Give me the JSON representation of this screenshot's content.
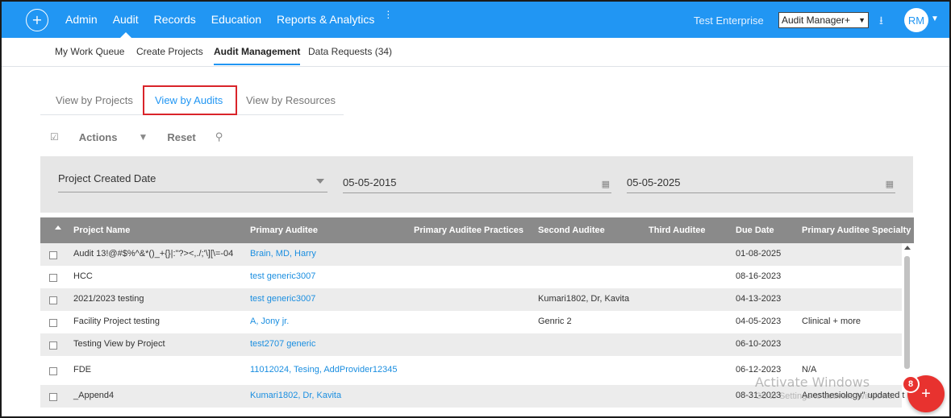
{
  "topbar": {
    "logo_glyph": "+",
    "nav": [
      {
        "label": "Admin"
      },
      {
        "label": "Audit"
      },
      {
        "label": "Records"
      },
      {
        "label": "Education"
      },
      {
        "label": "Reports & Analytics"
      }
    ],
    "enterprise": "Test Enterprise",
    "role": "Audit Manager+",
    "avatar_initials": "RM",
    "brand_color": "#2196f3"
  },
  "subnav": {
    "items": [
      {
        "label": "My Work Queue"
      },
      {
        "label": "Create Projects"
      },
      {
        "label": "Audit Management"
      },
      {
        "label": "Data Requests (34)"
      }
    ]
  },
  "view_tabs": {
    "items": [
      {
        "label": "View by Projects"
      },
      {
        "label": "View by Audits"
      },
      {
        "label": "View by Resources"
      }
    ]
  },
  "toolbar": {
    "actions_label": "Actions",
    "reset_label": "Reset"
  },
  "filter": {
    "field": "Project Created Date",
    "from_date": "05-05-2015",
    "to_date": "05-05-2025"
  },
  "table": {
    "columns": [
      "Project Name",
      "Primary Auditee",
      "Primary Auditee Practices",
      "Second Auditee",
      "Third Auditee",
      "Due Date",
      "Primary Auditee Specialty"
    ],
    "rows": [
      {
        "project": "Audit 13!@#$%^&*()_+{}|:\"?><,./;'\\][\\=-04",
        "primary": "Brain, MD, Harry",
        "practices": "",
        "second": "",
        "third": "",
        "due": "01-08-2025",
        "specialty": ""
      },
      {
        "project": "HCC",
        "primary": "test generic3007",
        "practices": "",
        "second": "",
        "third": "",
        "due": "08-16-2023",
        "specialty": ""
      },
      {
        "project": "2021/2023 testing",
        "primary": "test generic3007",
        "practices": "",
        "second": "Kumari1802, Dr, Kavita",
        "third": "",
        "due": "04-13-2023",
        "specialty": ""
      },
      {
        "project": "Facility Project testing",
        "primary": "A, Jony jr.",
        "practices": "",
        "second": "Genric 2",
        "third": "",
        "due": "04-05-2023",
        "specialty": "Clinical + more"
      },
      {
        "project": "Testing View by Project",
        "primary": "test2707 generic",
        "practices": "",
        "second": "",
        "third": "",
        "due": "06-10-2023",
        "specialty": ""
      },
      {
        "project": "FDE",
        "primary": "11012024, Tesing, AddProvider12345",
        "practices": "",
        "second": "",
        "third": "",
        "due": "06-12-2023",
        "specialty": "N/A"
      },
      {
        "project": "_Append4",
        "primary": "Kumari1802, Dr, Kavita",
        "practices": "",
        "second": "",
        "third": "",
        "due": "08-31-2023",
        "specialty": "Anesthesiology\" updated t"
      }
    ]
  },
  "watermark": {
    "line1": "Activate Windows",
    "line2": "Go to Settings to activate Windows."
  },
  "fab": {
    "badge": "8"
  }
}
